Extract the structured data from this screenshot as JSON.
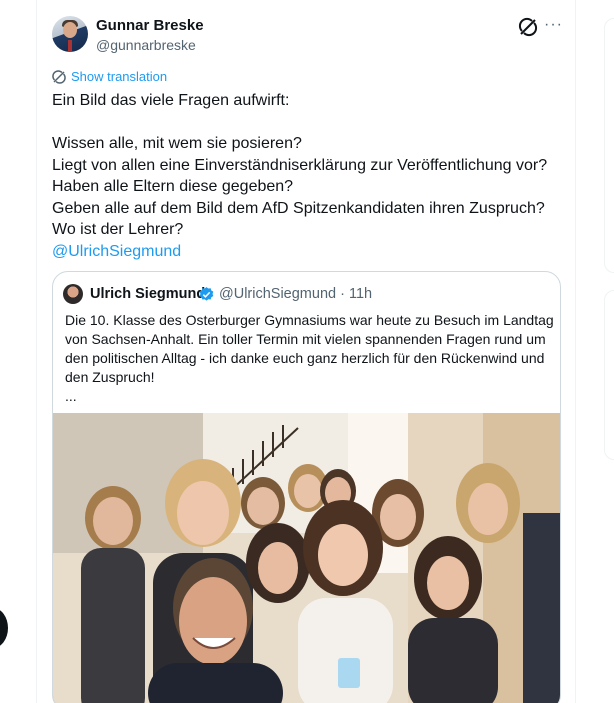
{
  "tweet": {
    "author_name": "Gunnar Breske",
    "author_handle": "@gunnarbreske",
    "show_translation": "Show translation",
    "lines": [
      "Ein Bild das viele Fragen aufwirft:",
      "",
      "Wissen alle, mit wem sie posieren?",
      "Liegt von allen eine Einverständniserklärung zur Veröffentlichung vor?",
      "Haben alle Eltern diese gegeben?",
      "Geben alle auf dem Bild dem AfD Spitzenkandidaten ihren Zuspruch?",
      "Wo ist der Lehrer?"
    ],
    "mention": "@UlrichSiegmund",
    "icons": {
      "grok": "grok-icon",
      "more": "more-icon",
      "translate": "translate-icon"
    },
    "more_glyph": "···"
  },
  "quote": {
    "author_name": "Ulrich Siegmund",
    "author_handle": "@UlrichSiegmund",
    "separator": "·",
    "time": "11h",
    "verified_color": "#1d9bf0",
    "lines": [
      "Die 10. Klasse des Osterburger Gymnasiums war heute zu Besuch im Landtag",
      "von Sachsen-Anhalt. Ein toller Termin mit vielen spannenden Fragen rund um",
      "den politischen Alltag - ich danke euch ganz herzlich für den Rückenwind und",
      "den Zuspruch!",
      "..."
    ]
  },
  "colors": {
    "accent": "#1d9bf0",
    "text": "#0f1419",
    "muted": "#536471",
    "border": "#cfd9de"
  }
}
